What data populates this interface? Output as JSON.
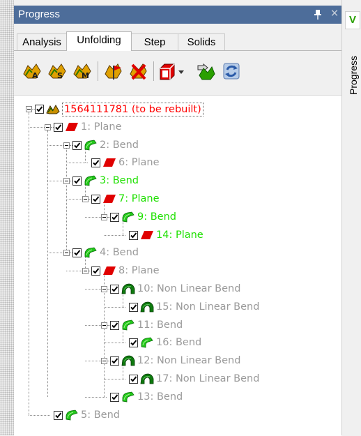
{
  "panel": {
    "title": "Progress",
    "pin_glyph": "■",
    "close_glyph": "×"
  },
  "tabs": [
    {
      "label": "Analysis",
      "active": false
    },
    {
      "label": "Unfolding",
      "active": true
    },
    {
      "label": "Step",
      "active": false
    },
    {
      "label": "Solids",
      "active": false
    }
  ],
  "toolbar": {
    "icons": [
      "unfold-a-icon",
      "unfold-s-icon",
      "unfold-m-icon",
      "flag-icon",
      "delete-flag-icon",
      "red-cube-dropdown-icon",
      "export-icon",
      "refresh-icon"
    ]
  },
  "tree": {
    "nodes": [
      {
        "id": "root",
        "label": "1564111781 (to be rebuilt)",
        "color": "red",
        "icon": "root-part-icon"
      },
      {
        "id": "n1",
        "label": "1: Plane",
        "color": "grey",
        "icon": "plane-icon"
      },
      {
        "id": "n2",
        "label": "2: Bend",
        "color": "grey",
        "icon": "bend-icon"
      },
      {
        "id": "n6",
        "label": "6: Plane",
        "color": "grey",
        "icon": "plane-icon"
      },
      {
        "id": "n3",
        "label": "3: Bend",
        "color": "green",
        "icon": "bend-icon"
      },
      {
        "id": "n7",
        "label": "7: Plane",
        "color": "green",
        "icon": "plane-icon"
      },
      {
        "id": "n9",
        "label": "9: Bend",
        "color": "green",
        "icon": "bend-icon"
      },
      {
        "id": "n14",
        "label": "14: Plane",
        "color": "green",
        "icon": "plane-icon"
      },
      {
        "id": "n4",
        "label": "4: Bend",
        "color": "grey",
        "icon": "bend-icon"
      },
      {
        "id": "n8",
        "label": "8: Plane",
        "color": "grey",
        "icon": "plane-icon"
      },
      {
        "id": "n10",
        "label": "10: Non Linear Bend",
        "color": "grey",
        "icon": "nonlinear-bend-icon"
      },
      {
        "id": "n15",
        "label": "15: Non Linear Bend",
        "color": "grey",
        "icon": "nonlinear-bend-icon"
      },
      {
        "id": "n11",
        "label": "11: Bend",
        "color": "grey",
        "icon": "bend-icon"
      },
      {
        "id": "n16",
        "label": "16: Bend",
        "color": "grey",
        "icon": "bend-icon"
      },
      {
        "id": "n12",
        "label": "12: Non Linear Bend",
        "color": "grey",
        "icon": "nonlinear-bend-icon"
      },
      {
        "id": "n17",
        "label": "17: Non Linear Bend",
        "color": "grey",
        "icon": "nonlinear-bend-icon"
      },
      {
        "id": "n13",
        "label": "13: Bend",
        "color": "grey",
        "icon": "bend-icon"
      },
      {
        "id": "n5",
        "label": "5: Bend",
        "color": "grey",
        "icon": "bend-icon"
      }
    ]
  },
  "side": {
    "tab_letter": "V",
    "vertical_label": "Progress"
  },
  "colors": {
    "titlebar": "#4d6d9a",
    "grey_text": "#9a9a9a",
    "green_text": "#1ee000",
    "red_text": "#ff0000",
    "plane_red": "#e00000",
    "bend_green": "#22c81a",
    "nonlinear_green": "#0e7a0e"
  }
}
